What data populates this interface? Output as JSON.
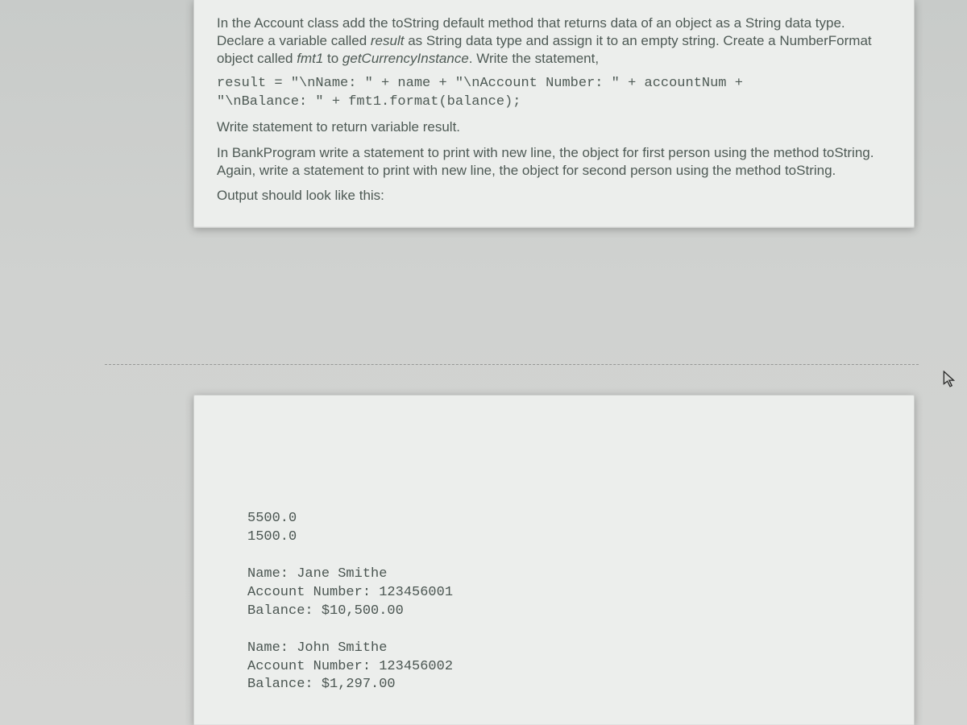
{
  "instructions": {
    "p1_pre": "In the Account class add the toString default method that returns data of an object as a String data type.  Declare a variable called ",
    "p1_var": "result",
    "p1_mid": " as String data type and assign it to an empty string. Create a NumberFormat object called ",
    "p1_fmt": "fmt1",
    "p1_mid2": "  to ",
    "p1_method": "getCurrencyInstance",
    "p1_post": ".  Write the statement,",
    "code_line1": "result = \"\\nName: \" + name + \"\\nAccount Number: \" + accountNum +",
    "code_line2": "\"\\nBalance: \" + fmt1.format(balance);",
    "p2": "Write statement to return variable result.",
    "p3": "In BankProgram write a statement to print with new line, the object for first person using the method toString.  Again, write a statement to print with new line, the object for second person using the method toString.",
    "p4": "Output should look like this:"
  },
  "output": {
    "lines": [
      "5500.0",
      "1500.0",
      "",
      "Name: Jane Smithe",
      "Account Number: 123456001",
      "Balance: $10,500.00",
      "",
      "Name: John Smithe",
      "Account Number: 123456002",
      "Balance: $1,297.00"
    ]
  }
}
